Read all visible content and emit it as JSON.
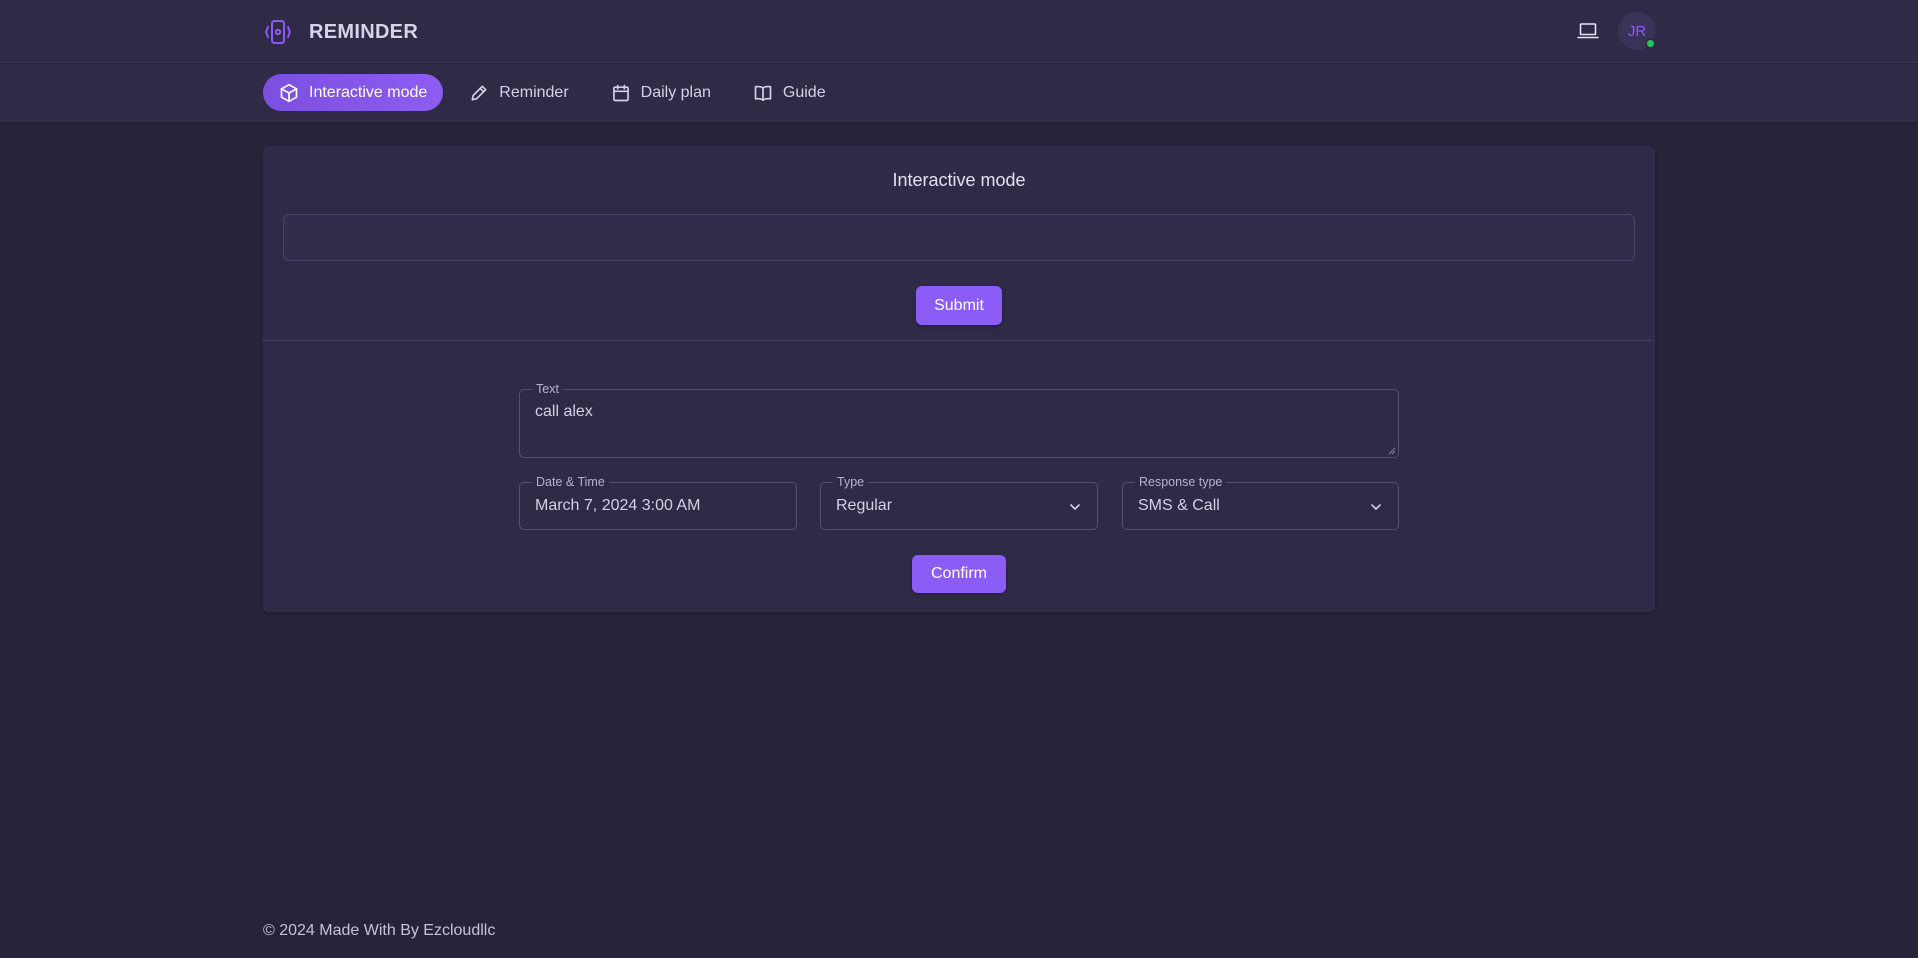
{
  "app": {
    "name": "REMINDER",
    "user_initials": "JR",
    "accent_color": "#8b5cf6",
    "status_color": "#22c55e"
  },
  "nav": {
    "items": [
      {
        "label": "Interactive mode",
        "icon": "cube-icon",
        "active": true
      },
      {
        "label": "Reminder",
        "icon": "pencil-icon",
        "active": false
      },
      {
        "label": "Daily plan",
        "icon": "calendar-icon",
        "active": false
      },
      {
        "label": "Guide",
        "icon": "book-open-icon",
        "active": false
      }
    ]
  },
  "main": {
    "title": "Interactive mode",
    "prompt_value": "",
    "submit_label": "Submit",
    "form": {
      "text_label": "Text",
      "text_value": "call alex",
      "datetime_label": "Date & Time",
      "datetime_value": "March 7, 2024 3:00 AM",
      "type_label": "Type",
      "type_value": "Regular",
      "response_label": "Response type",
      "response_value": "SMS & Call",
      "confirm_label": "Confirm"
    }
  },
  "footer": {
    "text": "© 2024 Made With By Ezcloudllc"
  }
}
